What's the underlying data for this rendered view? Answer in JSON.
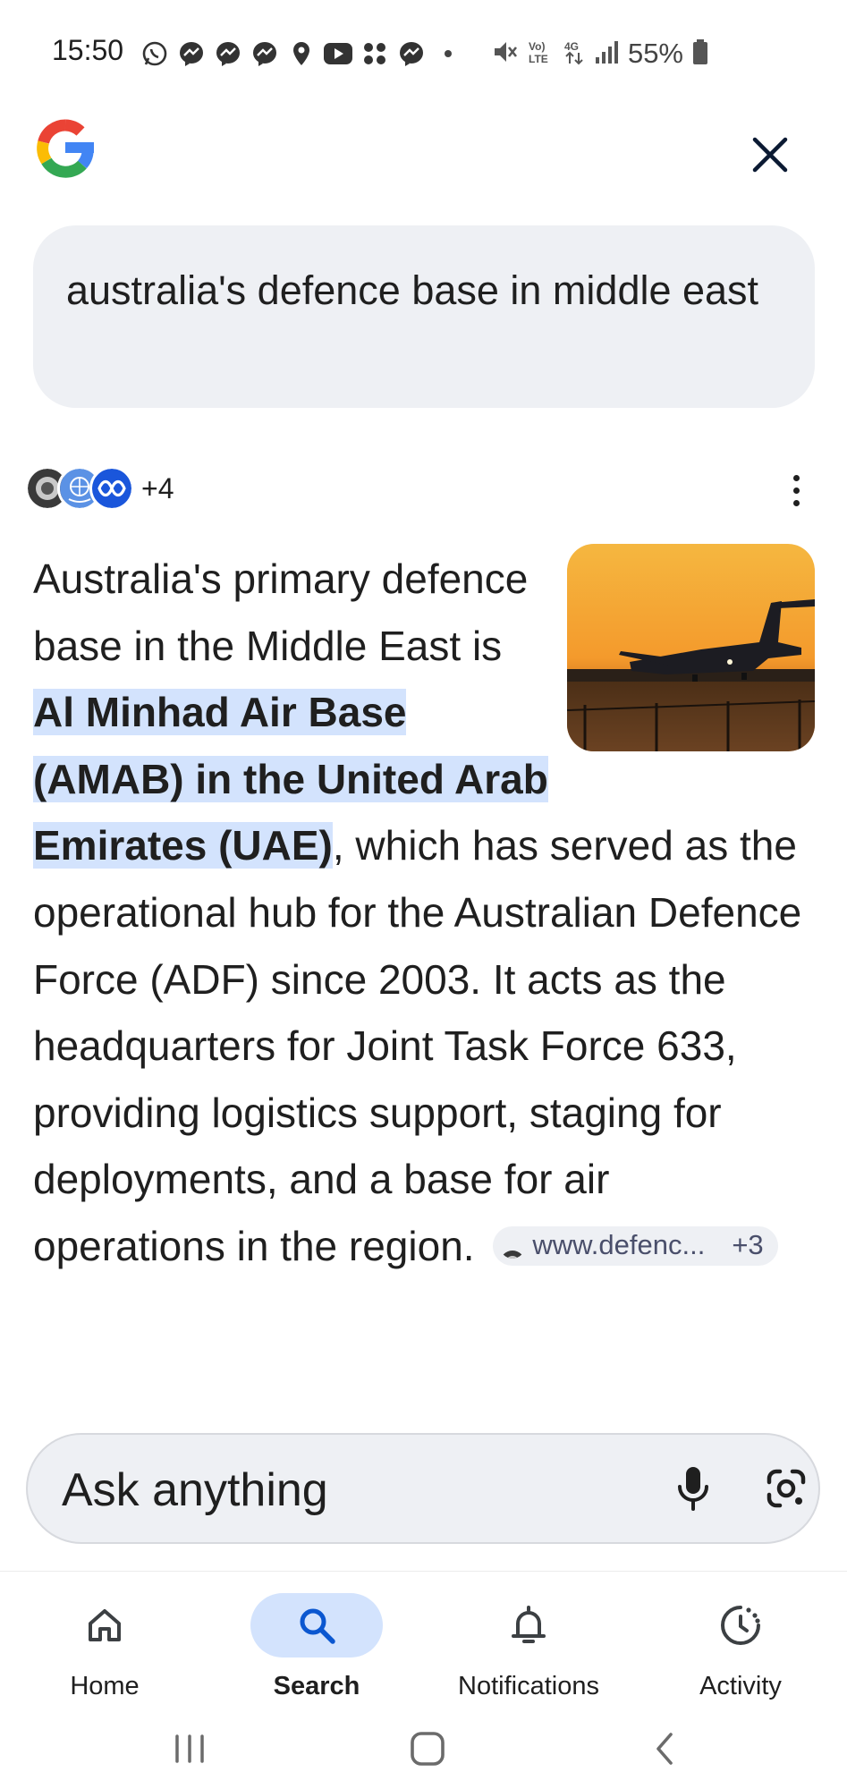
{
  "status_bar": {
    "time": "15:50",
    "battery": "55%",
    "left_icons": [
      "whatsapp-icon",
      "messenger-icon",
      "messenger-icon",
      "messenger-icon",
      "location-icon",
      "youtube-icon",
      "apps-icon",
      "messenger-icon",
      "dot-icon"
    ],
    "right_icons": [
      "mute-icon",
      "volte-icon",
      "4g-icon",
      "signal-icon",
      "battery-icon"
    ]
  },
  "header": {
    "logo": "google-g-logo",
    "close_icon": "close-icon"
  },
  "query": {
    "text": "australia's defence base in middle east"
  },
  "sources": {
    "more_count": "+4",
    "avatars": [
      "defence-crest",
      "un-emblem",
      "abc-logo"
    ]
  },
  "answer": {
    "intro": "Australia's primary defence base in the Middle East is ",
    "highlight": "Al Minhad Air Base (AMAB) in the United Arab Emirates (UAE)",
    "body": ", which has served as the operational hub for the Australian Defence Force (ADF) since 2003. It acts as the headquarters for Joint Task Force 633, providing logistics support, staging for deployments, and a base for air operations in the region.",
    "citation": {
      "site": "www.defenc...",
      "more": "+3"
    }
  },
  "ask_bar": {
    "placeholder": "Ask anything"
  },
  "bottom_nav": {
    "items": [
      {
        "label": "Home",
        "icon": "home-icon",
        "active": false
      },
      {
        "label": "Search",
        "icon": "search-icon",
        "active": true
      },
      {
        "label": "Notifications",
        "icon": "bell-icon",
        "active": false
      },
      {
        "label": "Activity",
        "icon": "activity-icon",
        "active": false
      }
    ]
  },
  "colors": {
    "accent": "#0b57d0",
    "highlight": "#d3e3fd",
    "surface": "#eef0f4"
  }
}
